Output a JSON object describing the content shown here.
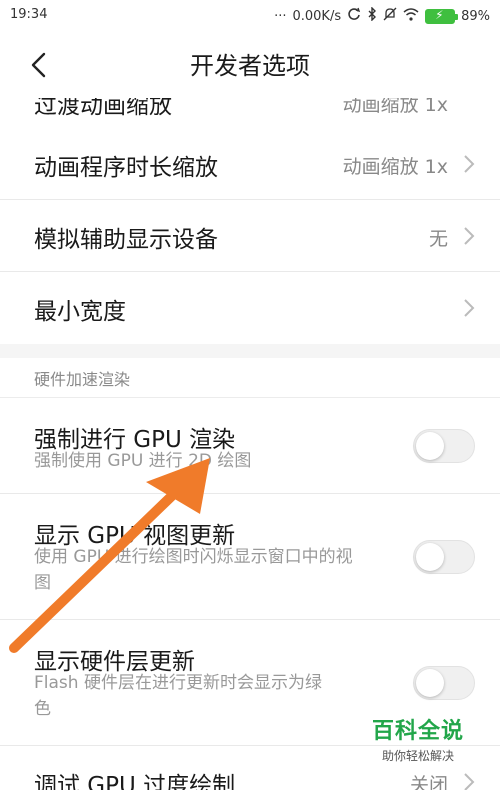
{
  "status": {
    "time": "19:34",
    "speed": "0.00K/s",
    "battery_pct": "89%",
    "icons": [
      "sync-icon",
      "bluetooth-icon",
      "mute-icon",
      "wifi-icon",
      "battery-icon"
    ]
  },
  "nav": {
    "title": "开发者选项",
    "back_icon": "back-chevron-icon"
  },
  "partial_row": {
    "label": "过渡动画缩放",
    "value": "动画缩放 1x"
  },
  "rows": [
    {
      "label": "动画程序时长缩放",
      "value": "动画缩放 1x"
    },
    {
      "label": "模拟辅助显示设备",
      "value": "无"
    },
    {
      "label": "最小宽度",
      "value": ""
    }
  ],
  "section": {
    "header": "硬件加速渲染"
  },
  "toggles": [
    {
      "label": "强制进行 GPU 渲染",
      "sub": "强制使用 GPU 进行 2D 绘图",
      "on": false
    },
    {
      "label": "显示 GPU 视图更新",
      "sub": "使用 GPU 进行绘图时闪烁显示窗口中的视图",
      "on": false
    },
    {
      "label": "显示硬件层更新",
      "sub": "Flash 硬件层在进行更新时会显示为绿色",
      "on": false
    }
  ],
  "bottom_row": {
    "label": "调试 GPU 过度绘制",
    "value": "关闭"
  },
  "watermark": {
    "title": "百科全说",
    "subtitle": "助你轻松解决"
  },
  "colors": {
    "arrow": "#f07b2a",
    "watermark_green": "#22a64a",
    "battery_green": "#3fbf3f"
  }
}
